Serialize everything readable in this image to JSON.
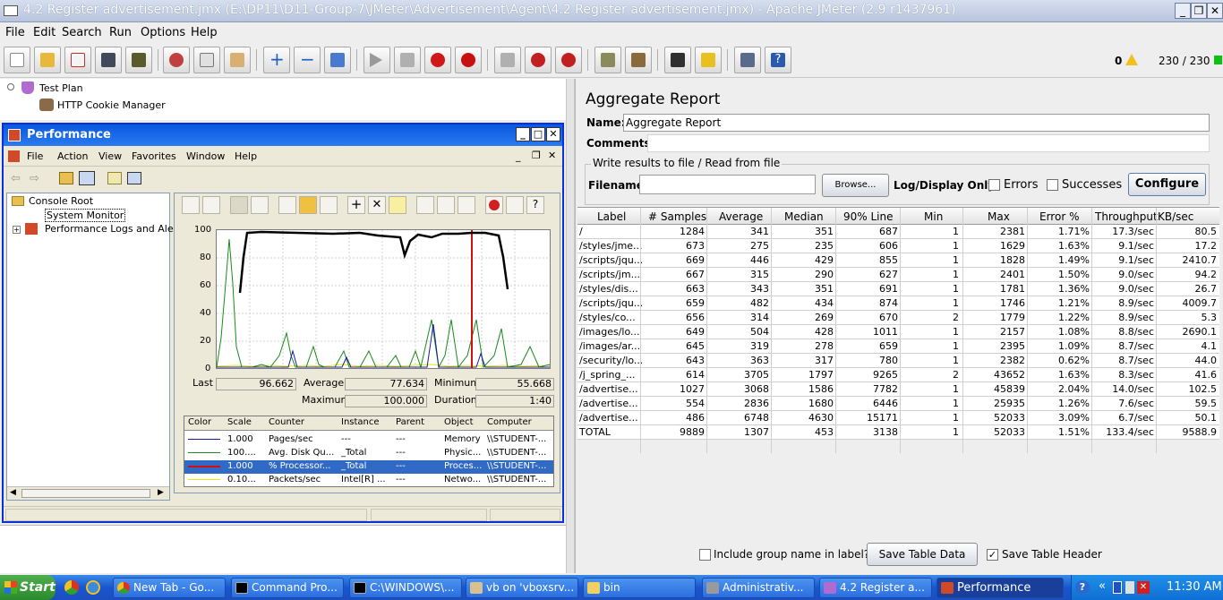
{
  "window": {
    "title": "4.2 Register advertisement.jmx (E:\\DP11\\D11-Group-7\\JMeter\\Advertisement\\Agent\\4.2 Register advertisement.jmx) - Apache JMeter (2.9 r1437961)"
  },
  "menu": [
    "File",
    "Edit",
    "Search",
    "Run",
    "Options",
    "Help"
  ],
  "toolbar_status": {
    "errors": "0",
    "threads": "230 / 230"
  },
  "tree": {
    "items": [
      "Test Plan",
      "HTTP Cookie Manager"
    ]
  },
  "perf": {
    "title": "Performance",
    "menu": [
      "File",
      "Action",
      "View",
      "Favorites",
      "Window",
      "Help"
    ],
    "tree": [
      "Console Root",
      "System Monitor",
      "Performance Logs and Alerts"
    ],
    "yticks": [
      "100",
      "80",
      "60",
      "40",
      "20",
      "0"
    ],
    "stats": {
      "last_label": "Last",
      "last": "96.662",
      "avg_label": "Average",
      "avg": "77.634",
      "min_label": "Minimum",
      "min": "55.668",
      "max_label": "Maximum",
      "max": "100.000",
      "dur_label": "Duration",
      "dur": "1:40"
    },
    "counter_headers": [
      "Color",
      "Scale",
      "Counter",
      "Instance",
      "Parent",
      "Object",
      "Computer"
    ],
    "counters": [
      {
        "color": "#1a1aa0",
        "scale": "1.000",
        "counter": "Pages/sec",
        "instance": "---",
        "parent": "---",
        "object": "Memory",
        "computer": "\\\\STUDENT-..."
      },
      {
        "color": "#1a8a1a",
        "scale": "100....",
        "counter": "Avg. Disk Qu...",
        "instance": "_Total",
        "parent": "---",
        "object": "Physic...",
        "computer": "\\\\STUDENT-..."
      },
      {
        "color": "#d01010",
        "scale": "1.000",
        "counter": "% Processor...",
        "instance": "_Total",
        "parent": "---",
        "object": "Proces...",
        "computer": "\\\\STUDENT-..."
      },
      {
        "color": "#e8e800",
        "scale": "0.10...",
        "counter": "Packets/sec",
        "instance": "Intel[R] ...",
        "parent": "---",
        "object": "Netwo...",
        "computer": "\\\\STUDENT-..."
      }
    ]
  },
  "report": {
    "title": "Aggregate Report",
    "name_label": "Name:",
    "name_value": "Aggregate Report",
    "comments_label": "Comments:",
    "file_group": "Write results to file / Read from file",
    "filename_label": "Filename",
    "browse": "Browse...",
    "log_only": "Log/Display Only:",
    "errors": "Errors",
    "successes": "Successes",
    "configure": "Configure",
    "headers": [
      "Label",
      "# Samples",
      "Average",
      "Median",
      "90% Line",
      "Min",
      "Max",
      "Error %",
      "Throughput",
      "KB/sec"
    ],
    "rows": [
      [
        "/",
        "1284",
        "341",
        "351",
        "687",
        "1",
        "2381",
        "1.71%",
        "17.3/sec",
        "80.5"
      ],
      [
        "/styles/jme...",
        "673",
        "275",
        "235",
        "606",
        "1",
        "1629",
        "1.63%",
        "9.1/sec",
        "17.2"
      ],
      [
        "/scripts/jqu...",
        "669",
        "446",
        "429",
        "855",
        "1",
        "1828",
        "1.49%",
        "9.1/sec",
        "2410.7"
      ],
      [
        "/scripts/jm...",
        "667",
        "315",
        "290",
        "627",
        "1",
        "2401",
        "1.50%",
        "9.0/sec",
        "94.2"
      ],
      [
        "/styles/dis...",
        "663",
        "343",
        "351",
        "691",
        "1",
        "1781",
        "1.36%",
        "9.0/sec",
        "26.7"
      ],
      [
        "/scripts/jqu...",
        "659",
        "482",
        "434",
        "874",
        "1",
        "1746",
        "1.21%",
        "8.9/sec",
        "4009.7"
      ],
      [
        "/styles/co...",
        "656",
        "314",
        "269",
        "670",
        "2",
        "1779",
        "1.22%",
        "8.9/sec",
        "5.3"
      ],
      [
        "/images/lo...",
        "649",
        "504",
        "428",
        "1011",
        "1",
        "2157",
        "1.08%",
        "8.8/sec",
        "2690.1"
      ],
      [
        "/images/ar...",
        "645",
        "319",
        "278",
        "659",
        "1",
        "2395",
        "1.09%",
        "8.7/sec",
        "4.1"
      ],
      [
        "/security/lo...",
        "643",
        "363",
        "317",
        "780",
        "1",
        "2382",
        "0.62%",
        "8.7/sec",
        "44.0"
      ],
      [
        "/j_spring_...",
        "614",
        "3705",
        "1797",
        "9265",
        "2",
        "43652",
        "1.63%",
        "8.3/sec",
        "41.6"
      ],
      [
        "/advertise...",
        "1027",
        "3068",
        "1586",
        "7782",
        "1",
        "45839",
        "2.04%",
        "14.0/sec",
        "102.5"
      ],
      [
        "/advertise...",
        "554",
        "2836",
        "1680",
        "6446",
        "1",
        "25935",
        "1.26%",
        "7.6/sec",
        "59.5"
      ],
      [
        "/advertise...",
        "486",
        "6748",
        "4630",
        "15171",
        "1",
        "52033",
        "3.09%",
        "6.7/sec",
        "50.1"
      ],
      [
        "TOTAL",
        "9889",
        "1307",
        "453",
        "3138",
        "1",
        "52033",
        "1.51%",
        "133.4/sec",
        "9588.9"
      ]
    ],
    "include_group": "Include group name in label?",
    "save_table": "Save Table Data",
    "save_header": "Save Table Header"
  },
  "taskbar": {
    "start": "Start",
    "tasks": [
      "New Tab - Go...",
      "Command Pro...",
      "C:\\WINDOWS\\...",
      "vb on 'vboxsrv...",
      "bin",
      "Administrativ...",
      "4.2 Register a...",
      "Performance"
    ],
    "clock": "11:30 AM"
  }
}
